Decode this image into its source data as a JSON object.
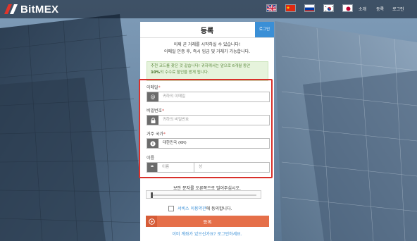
{
  "brand": {
    "name": "BitMEX"
  },
  "languages": [
    {
      "code": "en",
      "icon": "uk-flag-icon"
    },
    {
      "code": "zh",
      "icon": "china-flag-icon"
    },
    {
      "code": "ru",
      "icon": "russia-flag-icon"
    },
    {
      "code": "ko",
      "icon": "korea-flag-icon"
    },
    {
      "code": "ja",
      "icon": "japan-flag-icon"
    }
  ],
  "nav": {
    "about": "소개",
    "register": "등록",
    "login": "로그인"
  },
  "card": {
    "title": "등록",
    "login_button": "로그인",
    "intro_line1": "이제 곧 거래를 시작하실 수 있습니다!",
    "intro_line2": "이메일 인증 후, 즉시 입금 및 거래가 가능합니다.",
    "promo_line1": "추천 코드를 찾은 것 같습니다! 귀하께서는 앞으로 6개월 동안",
    "promo_bold": "10%",
    "promo_line2": "의 수수료 할인을 받게 됩니다."
  },
  "form": {
    "email_label": "이메일",
    "email_placeholder": "귀하의 이메일",
    "password_label": "비밀번호",
    "password_placeholder": "귀하의 비밀번호",
    "country_label": "거주 국가",
    "country_value": "대한민국 (KR)",
    "name_label": "이름",
    "first_name_placeholder": "이름",
    "last_name_placeholder": "성",
    "required_mark": "*"
  },
  "captcha": {
    "label": "보안 문자를 오른쪽으로 밀어주십시오."
  },
  "terms": {
    "link": "서비스 이용약관",
    "suffix": "에 동의합니다."
  },
  "submit_label": "등록",
  "login_link": "이미 계좌가 있으신가요? 로그인하세요.",
  "colors": {
    "accent": "#e56f49",
    "highlight": "#d9302b",
    "link": "#3a8fd6"
  }
}
